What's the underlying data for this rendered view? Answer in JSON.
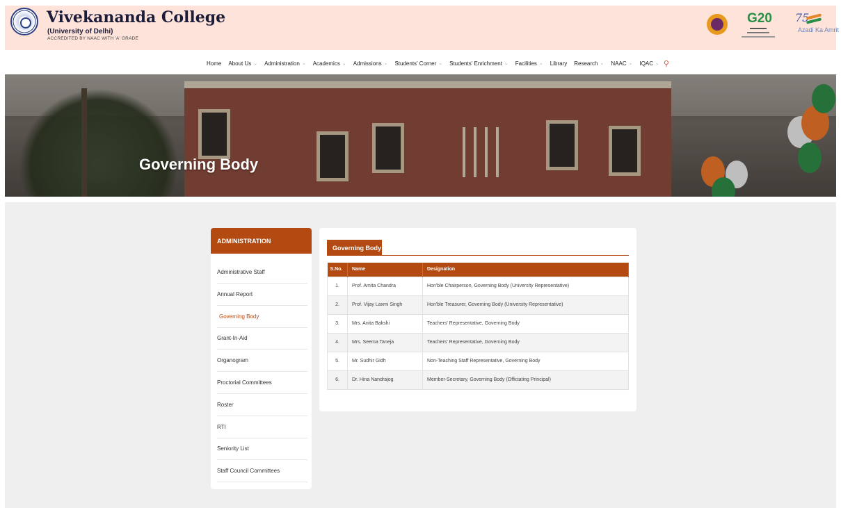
{
  "header": {
    "college_name": "Vivekananda College",
    "university": "(University of Delhi)",
    "accreditation": "ACCREDITED BY NAAC WITH 'A' GRADE",
    "emblem_azadi_number": "75",
    "emblem_azadi_text": "Azadi Ka Amrit Mahotsav",
    "emblem_g20_text": "G20"
  },
  "nav": {
    "items": [
      {
        "label": "Home",
        "has_dropdown": false
      },
      {
        "label": "About Us",
        "has_dropdown": true
      },
      {
        "label": "Administration",
        "has_dropdown": true
      },
      {
        "label": "Academics",
        "has_dropdown": true
      },
      {
        "label": "Admissions",
        "has_dropdown": true
      },
      {
        "label": "Students' Corner",
        "has_dropdown": true
      },
      {
        "label": "Students' Enrichment",
        "has_dropdown": true
      },
      {
        "label": "Facilities",
        "has_dropdown": true
      },
      {
        "label": "Library",
        "has_dropdown": false
      },
      {
        "label": "Research",
        "has_dropdown": true
      },
      {
        "label": "NAAC",
        "has_dropdown": true
      },
      {
        "label": "IQAC",
        "has_dropdown": true
      }
    ],
    "chevron_glyph": "⌄",
    "search_glyph": "⚲"
  },
  "banner": {
    "title": "Governing Body"
  },
  "sidebar": {
    "heading": "ADMINISTRATION",
    "items": [
      {
        "label": "Administrative Staff",
        "active": false
      },
      {
        "label": "Annual Report",
        "active": false
      },
      {
        "label": "Governing Body",
        "active": true
      },
      {
        "label": "Grant-In-Aid",
        "active": false
      },
      {
        "label": "Organogram",
        "active": false
      },
      {
        "label": "Proctorial Committees",
        "active": false
      },
      {
        "label": "Roster",
        "active": false
      },
      {
        "label": "RTI",
        "active": false
      },
      {
        "label": "Seniority List",
        "active": false
      },
      {
        "label": "Staff Council Committees",
        "active": false
      }
    ]
  },
  "panel": {
    "tab_label": "Governing Body",
    "table": {
      "headers": {
        "sno": "S.No.",
        "name": "Name",
        "designation": "Designation"
      },
      "rows": [
        {
          "sno": "1.",
          "name": "Prof. Amita Chandra",
          "designation": "Hon'ble Chairperson, Governing Body (University Representative)"
        },
        {
          "sno": "2.",
          "name": "Prof. Vijay Laxmi Singh",
          "designation": "Hon'ble Treasurer, Governing Body (University Representative)"
        },
        {
          "sno": "3.",
          "name": "Mrs. Anita Bakshi",
          "designation": "Teachers' Representative, Governing Body"
        },
        {
          "sno": "4.",
          "name": "Mrs. Seema Taneja",
          "designation": "Teachers' Representative, Governing Body"
        },
        {
          "sno": "5.",
          "name": "Mr. Sudhir Gidh",
          "designation": "Non-Teaching Staff Representative, Governing Body"
        },
        {
          "sno": "6.",
          "name": "Dr. Hina Nandrajog",
          "designation": "Member-Secretary, Governing Body (Officiating Principal)"
        }
      ]
    }
  },
  "colors": {
    "accent": "#b24a12",
    "header_bg": "#fde3d9",
    "content_bg": "#efefef"
  }
}
